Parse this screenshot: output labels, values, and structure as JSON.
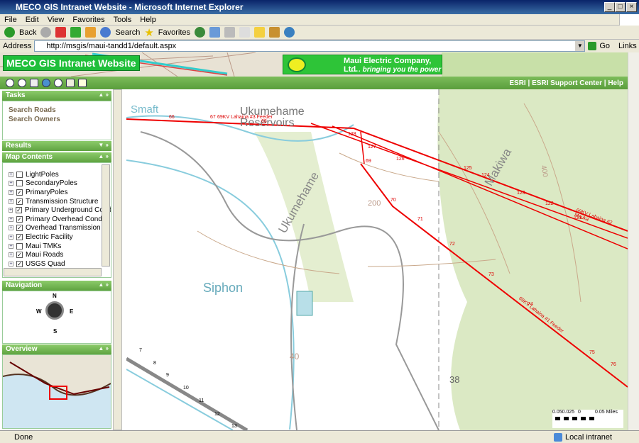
{
  "window": {
    "title": "MECO GIS Intranet Website - Microsoft Internet Explorer"
  },
  "menu": [
    "File",
    "Edit",
    "View",
    "Favorites",
    "Tools",
    "Help"
  ],
  "toolbar": {
    "back": "Back",
    "search": "Search",
    "favorites": "Favorites"
  },
  "address": {
    "label": "Address",
    "url": "http://msgis/maui-tandd1/default.aspx",
    "go": "Go",
    "links": "Links"
  },
  "site": {
    "title": "MECO GIS Intranet Website",
    "logo_name": "Maui Electric Company, Ltd.",
    "logo_tagline": ". . . bringing you the power"
  },
  "toplinks": [
    "ESRI",
    "ESRI Support Center",
    "Help"
  ],
  "panels": {
    "tasks": {
      "title": "Tasks",
      "items": [
        "Search Roads",
        "Search Owners"
      ]
    },
    "results": {
      "title": "Results"
    },
    "contents": {
      "title": "Map Contents",
      "layers": [
        {
          "name": "LightPoles",
          "checked": false
        },
        {
          "name": "SecondaryPoles",
          "checked": false
        },
        {
          "name": "PrimaryPoles",
          "checked": true
        },
        {
          "name": "Transmission Structure",
          "checked": true
        },
        {
          "name": "Primary Underground Cond",
          "checked": true
        },
        {
          "name": "Primary Overhead Conduc",
          "checked": true
        },
        {
          "name": "Overhead Transmission Li",
          "checked": true
        },
        {
          "name": "Electric Facility",
          "checked": true
        },
        {
          "name": "Maui TMKs",
          "checked": false
        },
        {
          "name": "Maui Roads",
          "checked": true
        },
        {
          "name": "USGS Quad",
          "checked": true
        }
      ]
    },
    "navigation": {
      "title": "Navigation",
      "n": "N",
      "s": "S",
      "e": "E",
      "w": "W"
    },
    "overview": {
      "title": "Overview"
    }
  },
  "map": {
    "labels": {
      "smaft": "Smaft",
      "reservoirs": "Ukumehame Reservoirs",
      "ukumehame": "Ukumehame",
      "siphon": "Siphon",
      "makiwa": "Makiwa",
      "c200": "200",
      "c40": "40",
      "c38": "38",
      "c400": "400",
      "feeder3": "69KV Lahaina #3 Feeder",
      "feeder2": "69KV Lahaina #2 Mauka",
      "feeder1": "69KV Lahaina #1 Feeder"
    },
    "poles": [
      "66",
      "67",
      "68",
      "69",
      "70",
      "71",
      "72",
      "73",
      "74",
      "75",
      "76",
      "128",
      "127",
      "126",
      "125",
      "124",
      "123",
      "122",
      "121",
      "7",
      "8",
      "9",
      "10",
      "11",
      "12",
      "13"
    ],
    "scale": {
      "left": "0.050.025",
      "zero": "0",
      "right": "0.05 Miles"
    }
  },
  "status": {
    "text": "Done",
    "zone": "Local intranet"
  }
}
